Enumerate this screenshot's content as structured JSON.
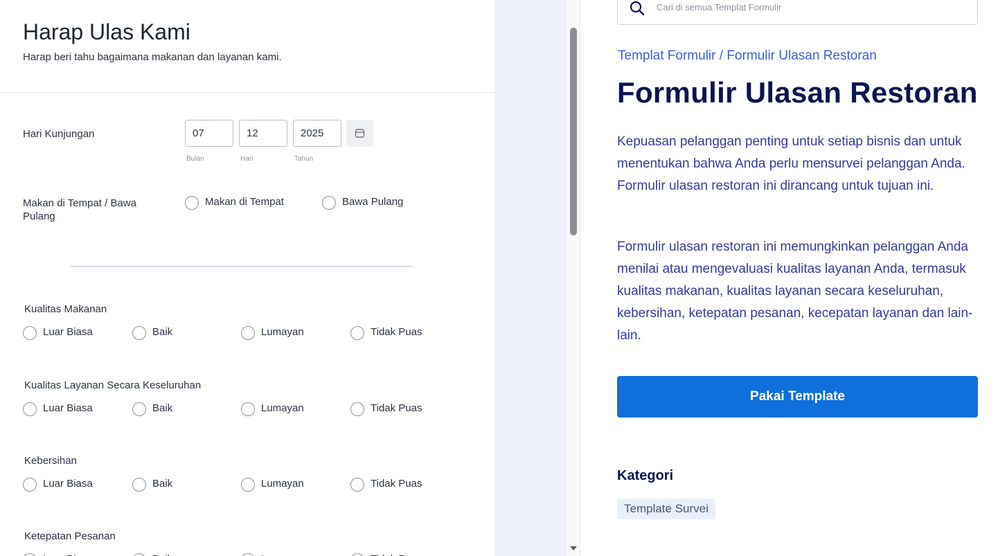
{
  "form": {
    "title": "Harap Ulas Kami",
    "subtitle": "Harap beri tahu bagaimana makanan dan layanan kami.",
    "visit_date": {
      "label": "Hari Kunjungan",
      "month": "07",
      "day": "12",
      "year": "2025",
      "month_label": "Bulan",
      "day_label": "Hari",
      "year_label": "Tahun"
    },
    "dine_option": {
      "label": "Makan di Tempat / Bawa Pulang",
      "options": [
        "Makan di Tempat",
        "Bawa Pulang"
      ]
    },
    "rating_options": [
      "Luar Biasa",
      "Baik",
      "Lumayan",
      "Tidak Puas"
    ],
    "ratings": [
      {
        "label": "Kualitas Makanan"
      },
      {
        "label": "Kualitas Layanan Secara Keseluruhan"
      },
      {
        "label": "Kebersihan"
      },
      {
        "label": "Ketepatan Pesanan"
      }
    ]
  },
  "info": {
    "search_placeholder": "Cari di semua Templat Formulir",
    "breadcrumb": {
      "parent": "Templat Formulir",
      "separator": " / ",
      "current": "Formulir Ulasan Restoran"
    },
    "title": "Formulir Ulasan Restoran",
    "description_1": "Kepuasan pelanggan penting untuk setiap bisnis dan untuk menentukan bahwa Anda perlu mensurvei pelanggan Anda. Formulir ulasan restoran ini dirancang untuk tujuan ini.",
    "description_2": "Formulir ulasan restoran ini memungkinkan pelanggan Anda menilai atau mengevaluasi kualitas layanan Anda, termasuk kualitas makanan, kualitas layanan secara keseluruhan, kebersihan, ketepatan pesanan, kecepatan layanan dan lain-lain.",
    "cta_label": "Pakai Template",
    "category_heading": "Kategori",
    "category_tag": "Template Survei"
  },
  "colors": {
    "accent": "#0f6fdc",
    "title_navy": "#0a1551",
    "link_blue": "#3a5ee0",
    "body_blue": "#343c9c",
    "gutter": "#eef1fb"
  },
  "icons": [
    "search-icon",
    "calendar-icon",
    "scroll-down-arrow-icon"
  ]
}
